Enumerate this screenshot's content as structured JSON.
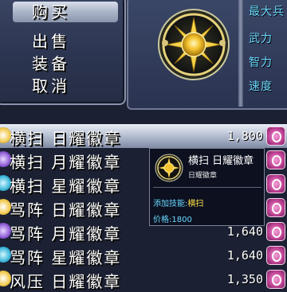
{
  "menu": {
    "items": [
      {
        "label": "购买",
        "selected": true
      },
      {
        "label": "出售",
        "selected": false
      },
      {
        "label": "装备",
        "selected": false
      },
      {
        "label": "取消",
        "selected": false
      }
    ]
  },
  "stats": {
    "labels": [
      "最大兵",
      "武力",
      "智力",
      "速度"
    ]
  },
  "items": [
    {
      "name": "横扫 日耀徽章",
      "price": "1,800",
      "selected": true,
      "icon": "sun-orb-icon",
      "color": "#f2c94c"
    },
    {
      "name": "横扫 月耀徽章",
      "price": "",
      "selected": false,
      "icon": "moon-orb-icon",
      "color": "#8e5bd6"
    },
    {
      "name": "横扫 星耀徽章",
      "price": "",
      "selected": false,
      "icon": "star-orb-icon",
      "color": "#3ab6d9"
    },
    {
      "name": "骂阵 日耀徽章",
      "price": "",
      "selected": false,
      "icon": "sun-orb-icon",
      "color": "#f2c94c"
    },
    {
      "name": "骂阵 月耀徽章",
      "price": "1,640",
      "selected": false,
      "icon": "moon-orb-icon",
      "color": "#8e5bd6"
    },
    {
      "name": "骂阵 星耀徽章",
      "price": "1,640",
      "selected": false,
      "icon": "star-orb-icon",
      "color": "#3ab6d9"
    },
    {
      "name": "风压 日耀徽章",
      "price": "1,350",
      "selected": false,
      "icon": "sun-orb-icon",
      "color": "#f2c94c"
    }
  ],
  "tooltip": {
    "title": "横扫 日耀徽章",
    "subtitle": "日耀徽章",
    "skill_label": "添加技能:",
    "skill_value": "横扫",
    "price_label": "价格:",
    "price_value": "1800"
  },
  "colors": {
    "accent_cyan": "#6ad8ff",
    "gold": "#ffe14a",
    "badge_pink": "#c4479a"
  }
}
